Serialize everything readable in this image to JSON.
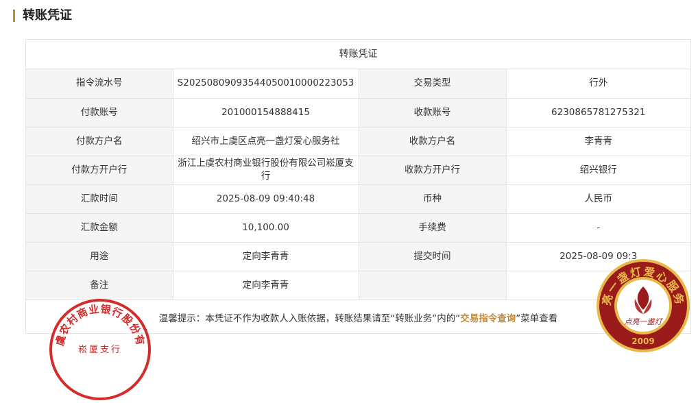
{
  "page": {
    "title": "转账凭证"
  },
  "voucher": {
    "title": "转账凭证",
    "rows": [
      {
        "l1": "指令流水号",
        "v1": "S2025080909354405001000022305​3",
        "l2": "交易类型",
        "v2": "行外"
      },
      {
        "l1": "付款账号",
        "v1": "201000154888415",
        "l2": "收款账号",
        "v2": "6230865781275321"
      },
      {
        "l1": "付款方户名",
        "v1": "绍兴市上虞区点亮一盏灯爱心服务社",
        "l2": "收款方户名",
        "v2": "李青青"
      },
      {
        "l1": "付款方开户行",
        "v1": "浙江上虞农村商业银行股份有限公司崧厦支行",
        "l2": "收款方开户行",
        "v2": "绍兴银行"
      },
      {
        "l1": "汇款时间",
        "v1": "2025-08-09 09:40:48",
        "l2": "币种",
        "v2": "人民币"
      },
      {
        "l1": "汇款金额",
        "v1": "10,100.00",
        "l2": "手续费",
        "v2": "-"
      },
      {
        "l1": "用途",
        "v1": "定向李青青",
        "l2": "提交时间",
        "v2": "2025-08-09 09:3"
      },
      {
        "l1": "备注",
        "v1": "定向李青青",
        "l2": "",
        "v2": ""
      }
    ],
    "tip": {
      "prefix": "温馨提示：本凭证不作为收款人入账依据，转账结果请至“转账业务”内的“",
      "link": "交易指令查询",
      "suffix": "”菜单查看"
    }
  },
  "seals": {
    "left": {
      "arc_text": "浙江上虞农村商业银行股份有限公司",
      "bottom_text": "崧厦支行",
      "color": "#d42b2b"
    },
    "right": {
      "arc_text": "点亮一盏灯爱心服务社",
      "center_text": "点亮一盏灯",
      "year": "2009",
      "color": "#9b1a1a",
      "ring_color": "#e8b84a"
    }
  },
  "colors": {
    "accent": "#c28a3a",
    "label_bg": "#f5f5f5",
    "border": "#e4e4e4"
  }
}
